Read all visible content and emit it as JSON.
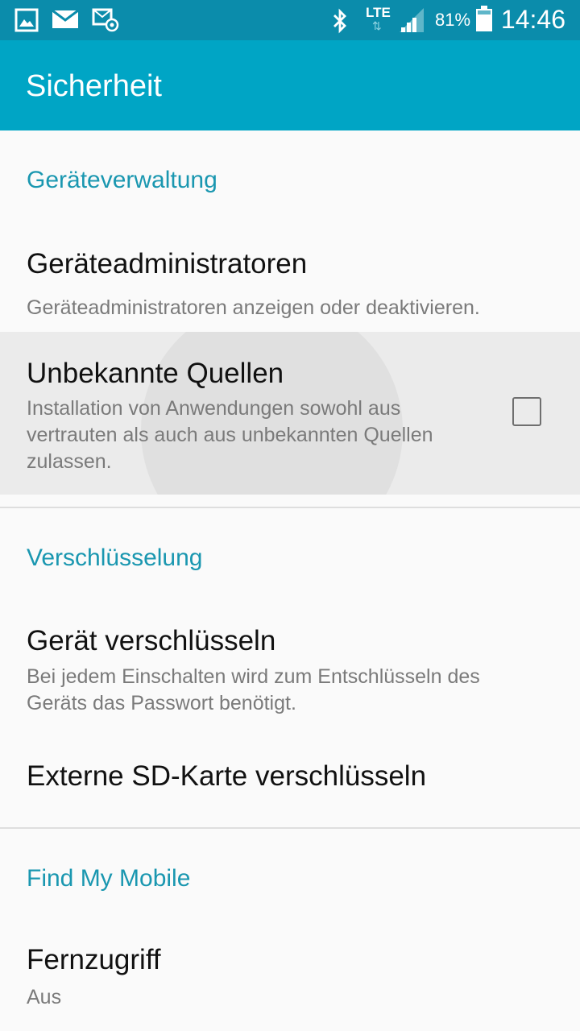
{
  "status_bar": {
    "icons_left": [
      "gallery-icon",
      "mail-icon",
      "email-at-icon"
    ],
    "icons_right": [
      "bluetooth-icon",
      "lte-icon",
      "signal-icon",
      "battery-icon"
    ],
    "network": "LTE",
    "battery": "81%",
    "time": "14:46"
  },
  "app_bar": {
    "title": "Sicherheit"
  },
  "sections": [
    {
      "header": "Geräteverwaltung",
      "items": [
        {
          "title": "Geräteadministratoren",
          "subtitle": "Geräteadministratoren anzeigen oder deaktivieren."
        },
        {
          "title": "Unbekannte Quellen",
          "subtitle_lines": [
            "Installation von Anwendungen sowohl aus",
            "vertrauten als auch aus unbekannten Quellen",
            "zulassen."
          ],
          "checked": false
        }
      ]
    },
    {
      "header": "Verschlüsselung",
      "items": [
        {
          "title": "Gerät verschlüsseln",
          "subtitle_lines": [
            "Bei jedem Einschalten wird zum Entschlüsseln des",
            "Geräts das Passwort benötigt."
          ]
        },
        {
          "title": "Externe SD-Karte verschlüsseln"
        }
      ]
    },
    {
      "header": "Find My Mobile",
      "items": [
        {
          "title": "Fernzugriff",
          "subtitle": "Aus"
        }
      ]
    }
  ],
  "colors": {
    "status_bar": "#0b8cab",
    "app_bar": "#00a5c5",
    "section_header": "#1a97b0",
    "pressed_bg": "#ebebeb"
  }
}
